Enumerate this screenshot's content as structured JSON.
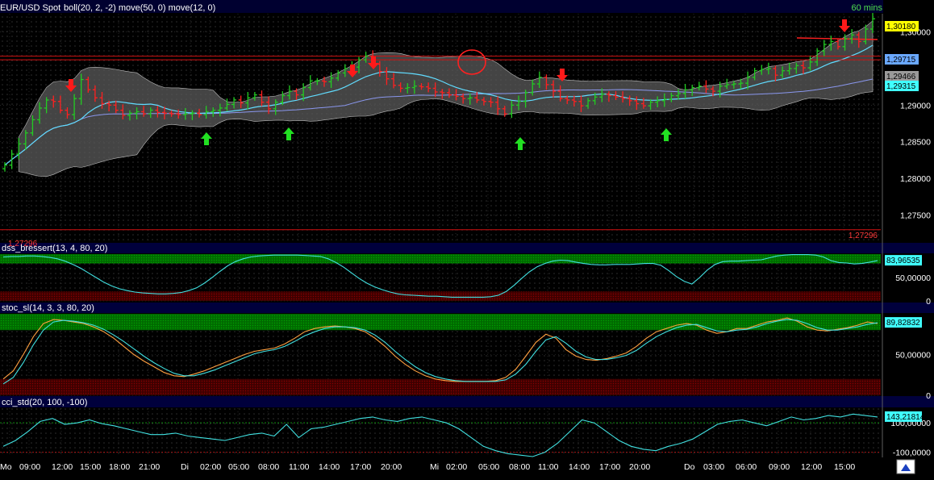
{
  "header": {
    "symbol": "EUR/USD Spot",
    "indicators": "boll(20, 2, -2) move(50, 0) move(12, 0)",
    "timeframe": "60 mins"
  },
  "colors": {
    "background": "#000000",
    "grid": "#3a3a3a",
    "bullish": "#22cc22",
    "bearish": "#ff2020",
    "band_fill": "#5a5a5a",
    "ma12": "#66e0ff",
    "ma50": "#9aa9ff",
    "overbought_zone": "#007a00",
    "oversold_zone": "#5a0000",
    "stoch_k": "#ffa040",
    "stoch_d": "#40e0e0",
    "cci_line": "#40e0e0",
    "panel_title_bar": "#00003c",
    "price_tag": "#ffff00",
    "signal_circle": "#ff2020"
  },
  "chart_data": [
    {
      "type": "line",
      "id": "price",
      "title": "EUR/USD Spot",
      "ylim": [
        1.2715,
        1.3025
      ],
      "y_ticks": [
        "1,30000",
        "1,29000",
        "1,28500",
        "1,28000",
        "1,27500"
      ],
      "y_tick_values": [
        1.3,
        1.29,
        1.285,
        1.28,
        1.275
      ],
      "price_tags": [
        {
          "label": "1,30180",
          "value": 1.3018,
          "color": "yellow"
        },
        {
          "label": "1,29715",
          "value": 1.29715,
          "color": "blue"
        },
        {
          "label": "1,29466",
          "value": 1.29466,
          "color": "gray"
        },
        {
          "label": "1,29315",
          "value": 1.29315,
          "color": "cyan"
        }
      ],
      "horizontal_lines": [
        {
          "label": "",
          "value": 1.2967
        },
        {
          "label": "",
          "value": 1.2962
        },
        {
          "label": "1,27296",
          "value": 1.27296
        }
      ],
      "closes": [
        1.2818,
        1.2833,
        1.2847,
        1.2862,
        1.288,
        1.2896,
        1.2907,
        1.2905,
        1.2893,
        1.2887,
        1.2909,
        1.2935,
        1.2921,
        1.291,
        1.2902,
        1.29,
        1.2893,
        1.2886,
        1.2889,
        1.2891,
        1.2888,
        1.2893,
        1.289,
        1.2889,
        1.2888,
        1.2887,
        1.2888,
        1.2889,
        1.2887,
        1.2891,
        1.2893,
        1.2896,
        1.2901,
        1.2907,
        1.2903,
        1.291,
        1.2914,
        1.2904,
        1.2895,
        1.2904,
        1.2913,
        1.2919,
        1.2914,
        1.2924,
        1.2933,
        1.2933,
        1.2932,
        1.2937,
        1.2944,
        1.295,
        1.2952,
        1.2962,
        1.2967,
        1.2956,
        1.2946,
        1.2936,
        1.2927,
        1.2923,
        1.2924,
        1.2926,
        1.2925,
        1.2923,
        1.2918,
        1.2917,
        1.2914,
        1.2912,
        1.2909,
        1.291,
        1.2907,
        1.2905,
        1.2904,
        1.2895,
        1.2888,
        1.29,
        1.2905,
        1.2917,
        1.2929,
        1.2938,
        1.2928,
        1.2919,
        1.2909,
        1.2907,
        1.2905,
        1.2899,
        1.2906,
        1.2911,
        1.2915,
        1.2913,
        1.2911,
        1.2909,
        1.2906,
        1.2902,
        1.2899,
        1.2904,
        1.2906,
        1.2908,
        1.2913,
        1.2916,
        1.2921,
        1.2924,
        1.2926,
        1.2922,
        1.2919,
        1.2926,
        1.2928,
        1.2929,
        1.293,
        1.2938,
        1.2947,
        1.2949,
        1.295,
        1.2941,
        1.2947,
        1.295,
        1.2954,
        1.2951,
        1.2959,
        1.2974,
        1.2983,
        1.2987,
        1.298,
        1.2991,
        1.2996,
        1.2987,
        1.3004,
        1.3018
      ],
      "arrows_down_at": [
        12,
        57,
        60,
        91,
        143
      ],
      "arrows_up_at": [
        33,
        48,
        86,
        111
      ],
      "series": [
        {
          "name": "Bollinger upper"
        },
        {
          "name": "Bollinger lower"
        },
        {
          "name": "move(50, 0)"
        },
        {
          "name": "move(12, 0)"
        }
      ]
    },
    {
      "type": "line",
      "id": "dss",
      "title": "dss_bressert(13, 4, 80, 20)",
      "ylim": [
        0,
        100
      ],
      "y_ticks": [
        "50,00000",
        "0"
      ],
      "y_tick_values": [
        50,
        0
      ],
      "zones": [
        80,
        20
      ],
      "last_value_label": "83,96535",
      "values": [
        94,
        95,
        95,
        96,
        96,
        95,
        93,
        90,
        85,
        78,
        70,
        60,
        50,
        40,
        32,
        26,
        22,
        19,
        17,
        16,
        15,
        15,
        16,
        18,
        22,
        28,
        38,
        50,
        63,
        75,
        84,
        90,
        94,
        96,
        97,
        98,
        98,
        98,
        98,
        97,
        96,
        95,
        90,
        82,
        72,
        60,
        48,
        38,
        30,
        24,
        19,
        15,
        13,
        12,
        11,
        10,
        10,
        9,
        8,
        8,
        8,
        8,
        8,
        9,
        12,
        20,
        33,
        48,
        62,
        73,
        80,
        85,
        87,
        86,
        83,
        80,
        78,
        77,
        77,
        78,
        78,
        78,
        79,
        80,
        80,
        76,
        65,
        52,
        42,
        36,
        50,
        66,
        78,
        84,
        85,
        85,
        86,
        87,
        88,
        92,
        96,
        98,
        99,
        99,
        99,
        98,
        94,
        86,
        82,
        81,
        79,
        80,
        83,
        86
      ]
    },
    {
      "type": "line",
      "id": "stoch",
      "title": "stoc_sl(14, 3, 3, 80, 20)",
      "ylim": [
        0,
        100
      ],
      "y_ticks": [
        "50,00000",
        "0"
      ],
      "y_tick_values": [
        50,
        0
      ],
      "zones": [
        80,
        20
      ],
      "last_value_label": "89,82832",
      "series": [
        {
          "name": "",
          "values": [
            20,
            30,
            50,
            72,
            88,
            93,
            92,
            90,
            88,
            84,
            78,
            70,
            60,
            50,
            42,
            35,
            28,
            24,
            23,
            26,
            30,
            35,
            40,
            45,
            50,
            54,
            56,
            58,
            63,
            70,
            78,
            82,
            84,
            85,
            84,
            82,
            78,
            70,
            60,
            48,
            38,
            30,
            24,
            20,
            18,
            17,
            17,
            17,
            17,
            18,
            22,
            32,
            48,
            65,
            75,
            70,
            56,
            48,
            44,
            43,
            45,
            48,
            52,
            60,
            70,
            78,
            82,
            86,
            88,
            86,
            80,
            76,
            78,
            82,
            82,
            86,
            90,
            92,
            95,
            91,
            84,
            80,
            79,
            81,
            83,
            86,
            90,
            88
          ]
        },
        {
          "name": "",
          "values": [
            14,
            22,
            40,
            62,
            80,
            90,
            92,
            91,
            89,
            86,
            81,
            74,
            66,
            57,
            48,
            40,
            33,
            27,
            24,
            24,
            27,
            31,
            36,
            41,
            46,
            51,
            54,
            56,
            60,
            66,
            73,
            78,
            82,
            84,
            84,
            83,
            80,
            74,
            65,
            54,
            44,
            35,
            28,
            23,
            20,
            18,
            17,
            17,
            17,
            17,
            19,
            26,
            38,
            54,
            68,
            72,
            64,
            54,
            47,
            44,
            44,
            46,
            49,
            55,
            64,
            72,
            78,
            83,
            86,
            87,
            83,
            79,
            78,
            80,
            81,
            84,
            88,
            91,
            93,
            92,
            88,
            83,
            80,
            80,
            82,
            84,
            87,
            89
          ]
        }
      ]
    },
    {
      "type": "line",
      "id": "cci",
      "title": "cci_std(20, 100, -100)",
      "ylim": [
        -130,
        200
      ],
      "y_ticks": [
        "100,00000",
        "-100,0000"
      ],
      "y_tick_values": [
        100,
        -100
      ],
      "levels": [
        100,
        -100
      ],
      "last_value_label": "143,21814",
      "values": [
        -60,
        -20,
        40,
        110,
        130,
        90,
        100,
        120,
        95,
        80,
        60,
        40,
        20,
        20,
        30,
        10,
        0,
        -10,
        -20,
        0,
        20,
        30,
        10,
        90,
        0,
        60,
        70,
        90,
        110,
        130,
        140,
        120,
        110,
        130,
        140,
        120,
        100,
        60,
        0,
        -60,
        -90,
        -110,
        -120,
        -130,
        -100,
        -40,
        40,
        120,
        100,
        40,
        -20,
        -60,
        -80,
        -90,
        -60,
        -40,
        -10,
        40,
        90,
        110,
        120,
        100,
        80,
        110,
        140,
        120,
        130,
        150,
        140,
        160,
        150,
        140
      ]
    }
  ],
  "x_axis": {
    "labels": [
      "Mo",
      "09:00",
      "12:00",
      "15:00",
      "18:00",
      "21:00",
      "Di",
      "02:00",
      "05:00",
      "08:00",
      "11:00",
      "14:00",
      "17:00",
      "20:00",
      "Mi",
      "02:00",
      "05:00",
      "08:00",
      "11:00",
      "14:00",
      "17:00",
      "20:00",
      "Do",
      "03:00",
      "06:00",
      "09:00",
      "12:00",
      "15:00"
    ]
  }
}
